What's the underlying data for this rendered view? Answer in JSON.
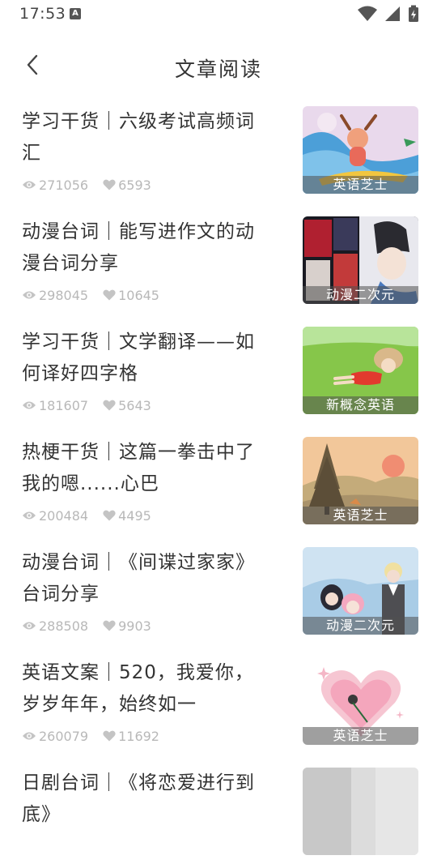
{
  "status_bar": {
    "time": "17:53",
    "notification_icon": "A",
    "icons": [
      "wifi-icon",
      "signal-icon",
      "battery-charging-icon"
    ]
  },
  "header": {
    "title": "文章阅读",
    "back_icon": "chevron-left-icon"
  },
  "articles": [
    {
      "title": "学习干货｜六级考试高频词汇",
      "views": "271056",
      "likes": "6593",
      "tag": "英语芝士"
    },
    {
      "title": "动漫台词｜能写进作文的动漫台词分享",
      "views": "298045",
      "likes": "10645",
      "tag": "动漫二次元"
    },
    {
      "title": "学习干货｜文学翻译——如何译好四字格",
      "views": "181607",
      "likes": "5643",
      "tag": "新概念英语"
    },
    {
      "title": "热梗干货｜这篇一拳击中了我的嗯......心巴",
      "views": "200484",
      "likes": "4495",
      "tag": "英语芝士"
    },
    {
      "title": "动漫台词｜《间谍过家家》台词分享",
      "views": "288508",
      "likes": "9903",
      "tag": "动漫二次元"
    },
    {
      "title": "英语文案｜520，我爱你，岁岁年年，始终如一",
      "views": "260079",
      "likes": "11692",
      "tag": "英语芝士"
    },
    {
      "title": "日剧台词｜《将恋爱进行到底》",
      "views": "",
      "likes": "",
      "tag": ""
    }
  ],
  "colors": {
    "title_text": "#333333",
    "stat_text": "#b8b8b8",
    "tag_bg": "rgba(80,80,80,0.55)"
  }
}
